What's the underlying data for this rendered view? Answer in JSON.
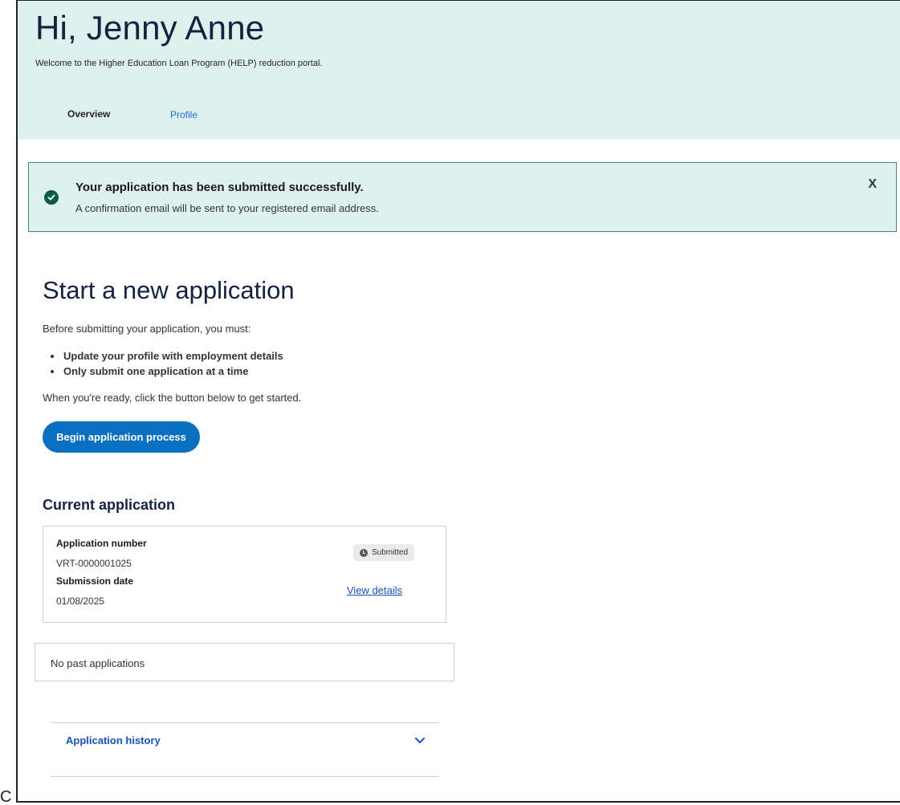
{
  "header": {
    "greeting": "Hi, Jenny Anne",
    "welcome": "Welcome to the Higher Education Loan Program (HELP) reduction portal.",
    "tabs": [
      {
        "label": "Overview",
        "active": true
      },
      {
        "label": "Profile",
        "active": false
      }
    ]
  },
  "alert": {
    "title": "Your application has been submitted successfully.",
    "message": "A confirmation email will be sent to your registered email address.",
    "close_label": "X",
    "icon": "check-circle-icon"
  },
  "new_application": {
    "title": "Start a new application",
    "intro": "Before submitting your application, you must:",
    "requirements": [
      "Update your profile with employment details",
      "Only submit one application at a time"
    ],
    "ready_text": "When you're ready, click the button below to get started.",
    "button_label": "Begin application process"
  },
  "current_application": {
    "title": "Current application",
    "number_label": "Application number",
    "number_value": "VRT-0000001025",
    "date_label": "Submission date",
    "date_value": "01/08/2025",
    "status": "Submitted",
    "view_link": "View details"
  },
  "past_applications": {
    "text": "No past applications"
  },
  "history": {
    "label": "Application history",
    "icon": "chevron-down-icon"
  },
  "stray_text": "C",
  "colors": {
    "header_bg": "#dff1ef",
    "alert_border": "#3f8a73",
    "primary_button": "#0a6fbf",
    "link": "#1a4fbf",
    "heading": "#13233f"
  }
}
